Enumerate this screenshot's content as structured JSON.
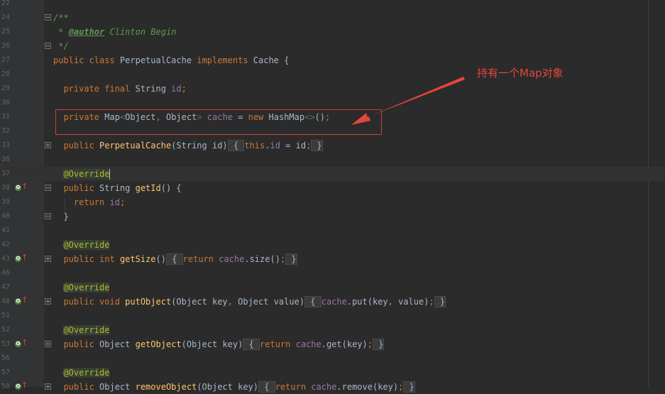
{
  "editor": {
    "lines": [
      {
        "num": "22",
        "parts": []
      },
      {
        "num": "24",
        "parts": [
          {
            "t": "/**",
            "c": "cmt"
          }
        ]
      },
      {
        "num": "25",
        "parts": [
          {
            "t": " * ",
            "c": "cmt"
          },
          {
            "t": "@author",
            "c": "tag"
          },
          {
            "t": " Clinton Begin",
            "c": "cmt"
          }
        ]
      },
      {
        "num": "26",
        "parts": [
          {
            "t": " */",
            "c": "cmt"
          }
        ]
      },
      {
        "num": "27",
        "parts": [
          {
            "t": "public class ",
            "c": "kw"
          },
          {
            "t": "PerpetualCache ",
            "c": ""
          },
          {
            "t": "implements ",
            "c": "kw"
          },
          {
            "t": "Cache {",
            "c": ""
          }
        ]
      },
      {
        "num": "28",
        "parts": []
      },
      {
        "num": "29",
        "parts": [
          {
            "t": "  private final ",
            "c": "kw"
          },
          {
            "t": "String ",
            "c": ""
          },
          {
            "t": "id",
            "c": "fld"
          },
          {
            "t": ";",
            "c": "kw"
          }
        ]
      },
      {
        "num": "30",
        "parts": []
      },
      {
        "num": "31",
        "parts": [
          {
            "t": "  private ",
            "c": "kw"
          },
          {
            "t": "Map",
            "c": ""
          },
          {
            "t": "<",
            "c": "gen"
          },
          {
            "t": "Object",
            "c": ""
          },
          {
            "t": ", ",
            "c": "kw"
          },
          {
            "t": "Object",
            "c": ""
          },
          {
            "t": "> ",
            "c": "gen"
          },
          {
            "t": "cache",
            "c": "fld"
          },
          {
            "t": " = ",
            "c": ""
          },
          {
            "t": "new ",
            "c": "kw"
          },
          {
            "t": "HashMap",
            "c": ""
          },
          {
            "t": "<>",
            "c": "gen"
          },
          {
            "t": "()",
            "c": ""
          },
          {
            "t": ";",
            "c": "kw"
          }
        ]
      },
      {
        "num": "32",
        "parts": []
      },
      {
        "num": "33",
        "parts": [
          {
            "t": "  public ",
            "c": "kw"
          },
          {
            "t": "PerpetualCache",
            "c": "mth"
          },
          {
            "t": "(String id)",
            "c": ""
          },
          {
            "t": " { ",
            "c": "bracehl"
          },
          {
            "t": "this",
            "c": "kw"
          },
          {
            "t": ".",
            "c": ""
          },
          {
            "t": "id",
            "c": "fld"
          },
          {
            "t": " = id",
            "c": ""
          },
          {
            "t": ";",
            "c": "kw"
          },
          {
            "t": " }",
            "c": "bracehl"
          }
        ]
      },
      {
        "num": "36",
        "parts": []
      },
      {
        "num": "37",
        "current": true,
        "parts": [
          {
            "t": "  ",
            "c": ""
          },
          {
            "t": "@Override",
            "c": "ann-hl"
          },
          {
            "t": "",
            "c": "caret"
          }
        ]
      },
      {
        "num": "38",
        "override": true,
        "parts": [
          {
            "t": "  public ",
            "c": "kw"
          },
          {
            "t": "String ",
            "c": ""
          },
          {
            "t": "getId",
            "c": "mth"
          },
          {
            "t": "() {",
            "c": ""
          }
        ]
      },
      {
        "num": "39",
        "parts": [
          {
            "t": "    return ",
            "c": "kw"
          },
          {
            "t": "id",
            "c": "fld"
          },
          {
            "t": ";",
            "c": "kw"
          }
        ]
      },
      {
        "num": "40",
        "parts": [
          {
            "t": "  }",
            "c": ""
          }
        ]
      },
      {
        "num": "41",
        "parts": []
      },
      {
        "num": "42",
        "parts": [
          {
            "t": "  ",
            "c": ""
          },
          {
            "t": "@Override",
            "c": "ann-hl"
          }
        ]
      },
      {
        "num": "43",
        "override": true,
        "parts": [
          {
            "t": "  public ",
            "c": "kw"
          },
          {
            "t": "int ",
            "c": "kw"
          },
          {
            "t": "getSize",
            "c": "mth"
          },
          {
            "t": "()",
            "c": ""
          },
          {
            "t": " { ",
            "c": "bracehl"
          },
          {
            "t": "return ",
            "c": "kw"
          },
          {
            "t": "cache",
            "c": "fld"
          },
          {
            "t": ".size()",
            "c": ""
          },
          {
            "t": ";",
            "c": "kw"
          },
          {
            "t": " }",
            "c": "bracehl"
          }
        ]
      },
      {
        "num": "46",
        "parts": []
      },
      {
        "num": "47",
        "parts": [
          {
            "t": "  ",
            "c": ""
          },
          {
            "t": "@Override",
            "c": "ann-hl"
          }
        ]
      },
      {
        "num": "48",
        "override": true,
        "parts": [
          {
            "t": "  public ",
            "c": "kw"
          },
          {
            "t": "void ",
            "c": "kw"
          },
          {
            "t": "putObject",
            "c": "mth"
          },
          {
            "t": "(Object key",
            "c": ""
          },
          {
            "t": ", ",
            "c": "kw"
          },
          {
            "t": "Object value)",
            "c": ""
          },
          {
            "t": " { ",
            "c": "bracehl"
          },
          {
            "t": "cache",
            "c": "fld"
          },
          {
            "t": ".put(key",
            "c": ""
          },
          {
            "t": ", ",
            "c": "kw"
          },
          {
            "t": "value)",
            "c": ""
          },
          {
            "t": ";",
            "c": "kw"
          },
          {
            "t": " }",
            "c": "bracehl"
          }
        ]
      },
      {
        "num": "51",
        "parts": []
      },
      {
        "num": "52",
        "parts": [
          {
            "t": "  ",
            "c": ""
          },
          {
            "t": "@Override",
            "c": "ann-hl"
          }
        ]
      },
      {
        "num": "53",
        "override": true,
        "parts": [
          {
            "t": "  public ",
            "c": "kw"
          },
          {
            "t": "Object ",
            "c": ""
          },
          {
            "t": "getObject",
            "c": "mth"
          },
          {
            "t": "(Object key)",
            "c": ""
          },
          {
            "t": " { ",
            "c": "bracehl"
          },
          {
            "t": "return ",
            "c": "kw"
          },
          {
            "t": "cache",
            "c": "fld"
          },
          {
            "t": ".get(key)",
            "c": ""
          },
          {
            "t": ";",
            "c": "kw"
          },
          {
            "t": " }",
            "c": "bracehl"
          }
        ]
      },
      {
        "num": "56",
        "parts": []
      },
      {
        "num": "57",
        "parts": [
          {
            "t": "  ",
            "c": ""
          },
          {
            "t": "@Override",
            "c": "ann-hl"
          }
        ]
      },
      {
        "num": "58",
        "override": true,
        "parts": [
          {
            "t": "  public ",
            "c": "kw"
          },
          {
            "t": "Object ",
            "c": ""
          },
          {
            "t": "removeObject",
            "c": "mth"
          },
          {
            "t": "(Object key)",
            "c": ""
          },
          {
            "t": " { ",
            "c": "bracehl"
          },
          {
            "t": "return ",
            "c": "kw"
          },
          {
            "t": "cache",
            "c": "fld"
          },
          {
            "t": ".remove(key)",
            "c": ""
          },
          {
            "t": ";",
            "c": "kw"
          },
          {
            "t": " }",
            "c": "bracehl"
          }
        ]
      }
    ]
  },
  "annotation": {
    "callout_text": "持有一个Map对象",
    "color": "#e5463c"
  },
  "theme": {
    "background": "#2b2b2b",
    "keyword": "#cc7832",
    "annotation": "#bbb529",
    "field": "#9876aa",
    "method": "#ffc66d",
    "comment": "#629755"
  }
}
